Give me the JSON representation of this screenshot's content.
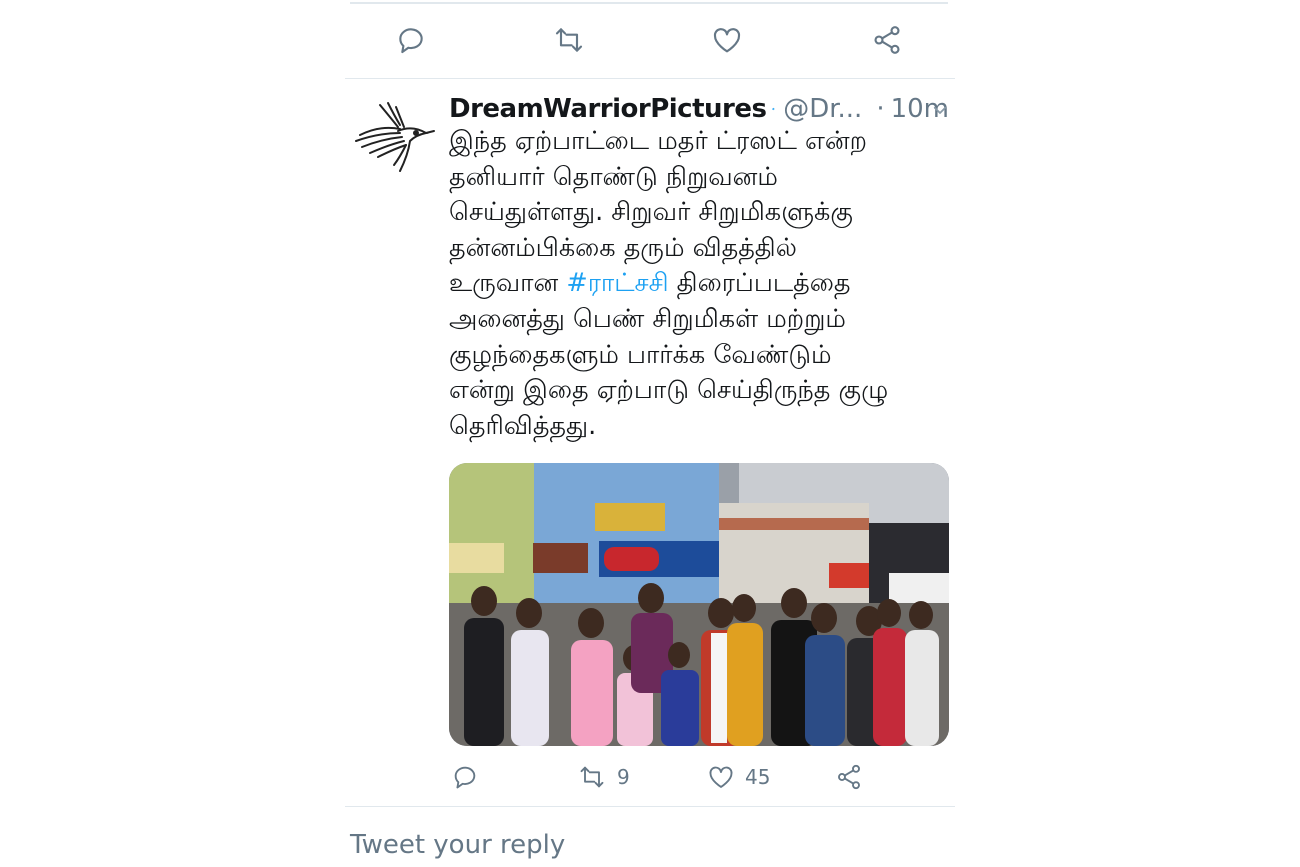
{
  "tweet": {
    "display_name": "DreamWarriorPictures",
    "handle": "@Dr...",
    "separator": "·",
    "time": "10m",
    "text_lines": [
      "இந்த ஏற்பாட்டை மதர் ட்ரஸட் என்ற",
      "தனியார் தொண்டு நிறுவனம்",
      "செய்துள்ளது. சிறுவர் சிறுமிகளுக்கு",
      "தன்னம்பிக்கை தரும் விதத்தில்",
      "உருவான ",
      "அனைத்து பெண் சிறுமிகள் மற்றும்",
      "குழந்தைகளும் பார்க்க வேண்டும்",
      "என்று இதை ஏற்பாடு செய்திருந்த குழு",
      "தெரிவித்தது."
    ],
    "hashtag": "#ராட்சசி",
    "text_after_hashtag": " திரைப்படத்தை",
    "retweet_count": "9",
    "like_count": "45"
  },
  "reply_box": {
    "placeholder": "Tweet your reply"
  },
  "icons": {
    "top_actions": [
      "reply-icon",
      "retweet-icon",
      "like-icon",
      "share-icon"
    ],
    "verified": "verified-badge-icon",
    "caret": "chevron-down-icon"
  },
  "colors": {
    "link": "#1da1f2",
    "muted": "#657786",
    "verified": "#1da1f2",
    "divider": "#e1e8ed"
  }
}
